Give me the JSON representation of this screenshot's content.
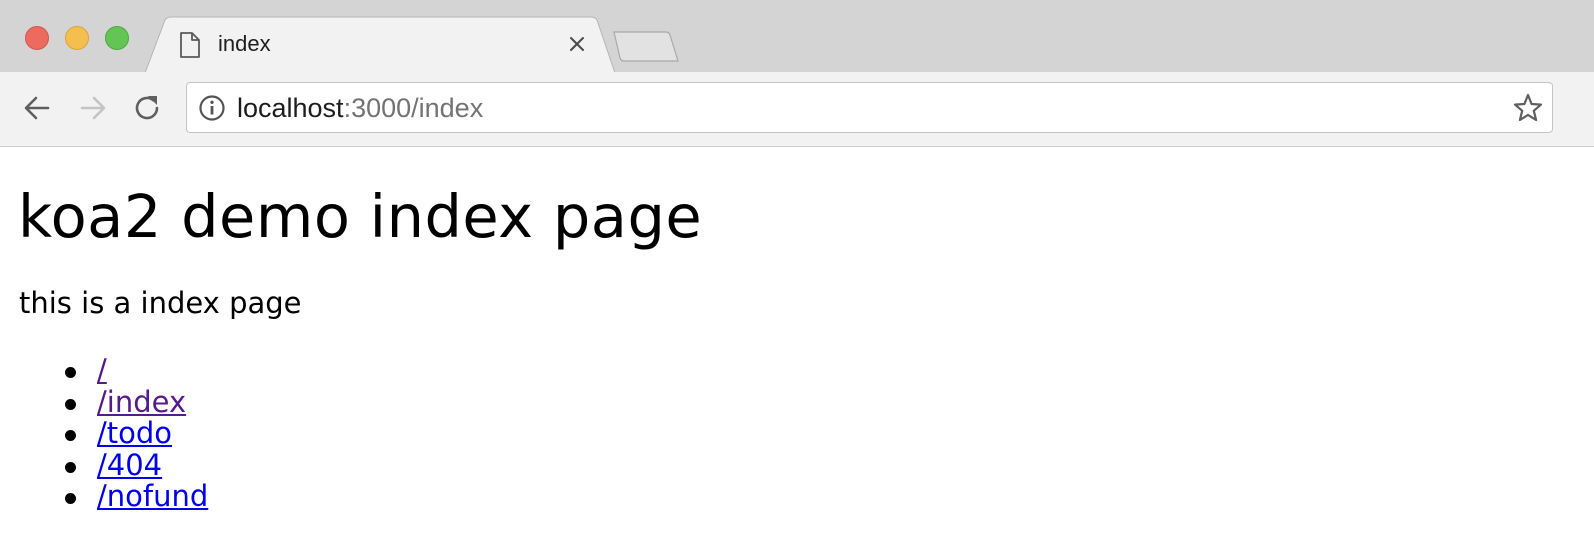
{
  "browser": {
    "tab": {
      "title": "index",
      "favicon_icon": "page-icon",
      "close_icon": "close-icon"
    },
    "toolbar": {
      "back_icon": "arrow-left-icon",
      "forward_icon": "arrow-right-icon",
      "reload_icon": "reload-icon",
      "address": {
        "info_icon": "info-icon",
        "host": "localhost",
        "rest": ":3000/index",
        "bookmark_icon": "star-icon"
      }
    },
    "colors": {
      "tab_strip": "#d5d4d5",
      "toolbar": "#f2f2f2",
      "close_light": "#ed6a5e",
      "minimize_light": "#f5bf4f",
      "maximize_light": "#62c554",
      "link": "#0000ee",
      "visited_link": "#551a8b"
    }
  },
  "page": {
    "heading": "koa2 demo index page",
    "description": "this is a index page",
    "links": [
      {
        "label": "/",
        "visited": true
      },
      {
        "label": "/index",
        "visited": true
      },
      {
        "label": "/todo",
        "visited": false
      },
      {
        "label": "/404",
        "visited": false
      },
      {
        "label": "/nofund",
        "visited": false
      }
    ]
  }
}
